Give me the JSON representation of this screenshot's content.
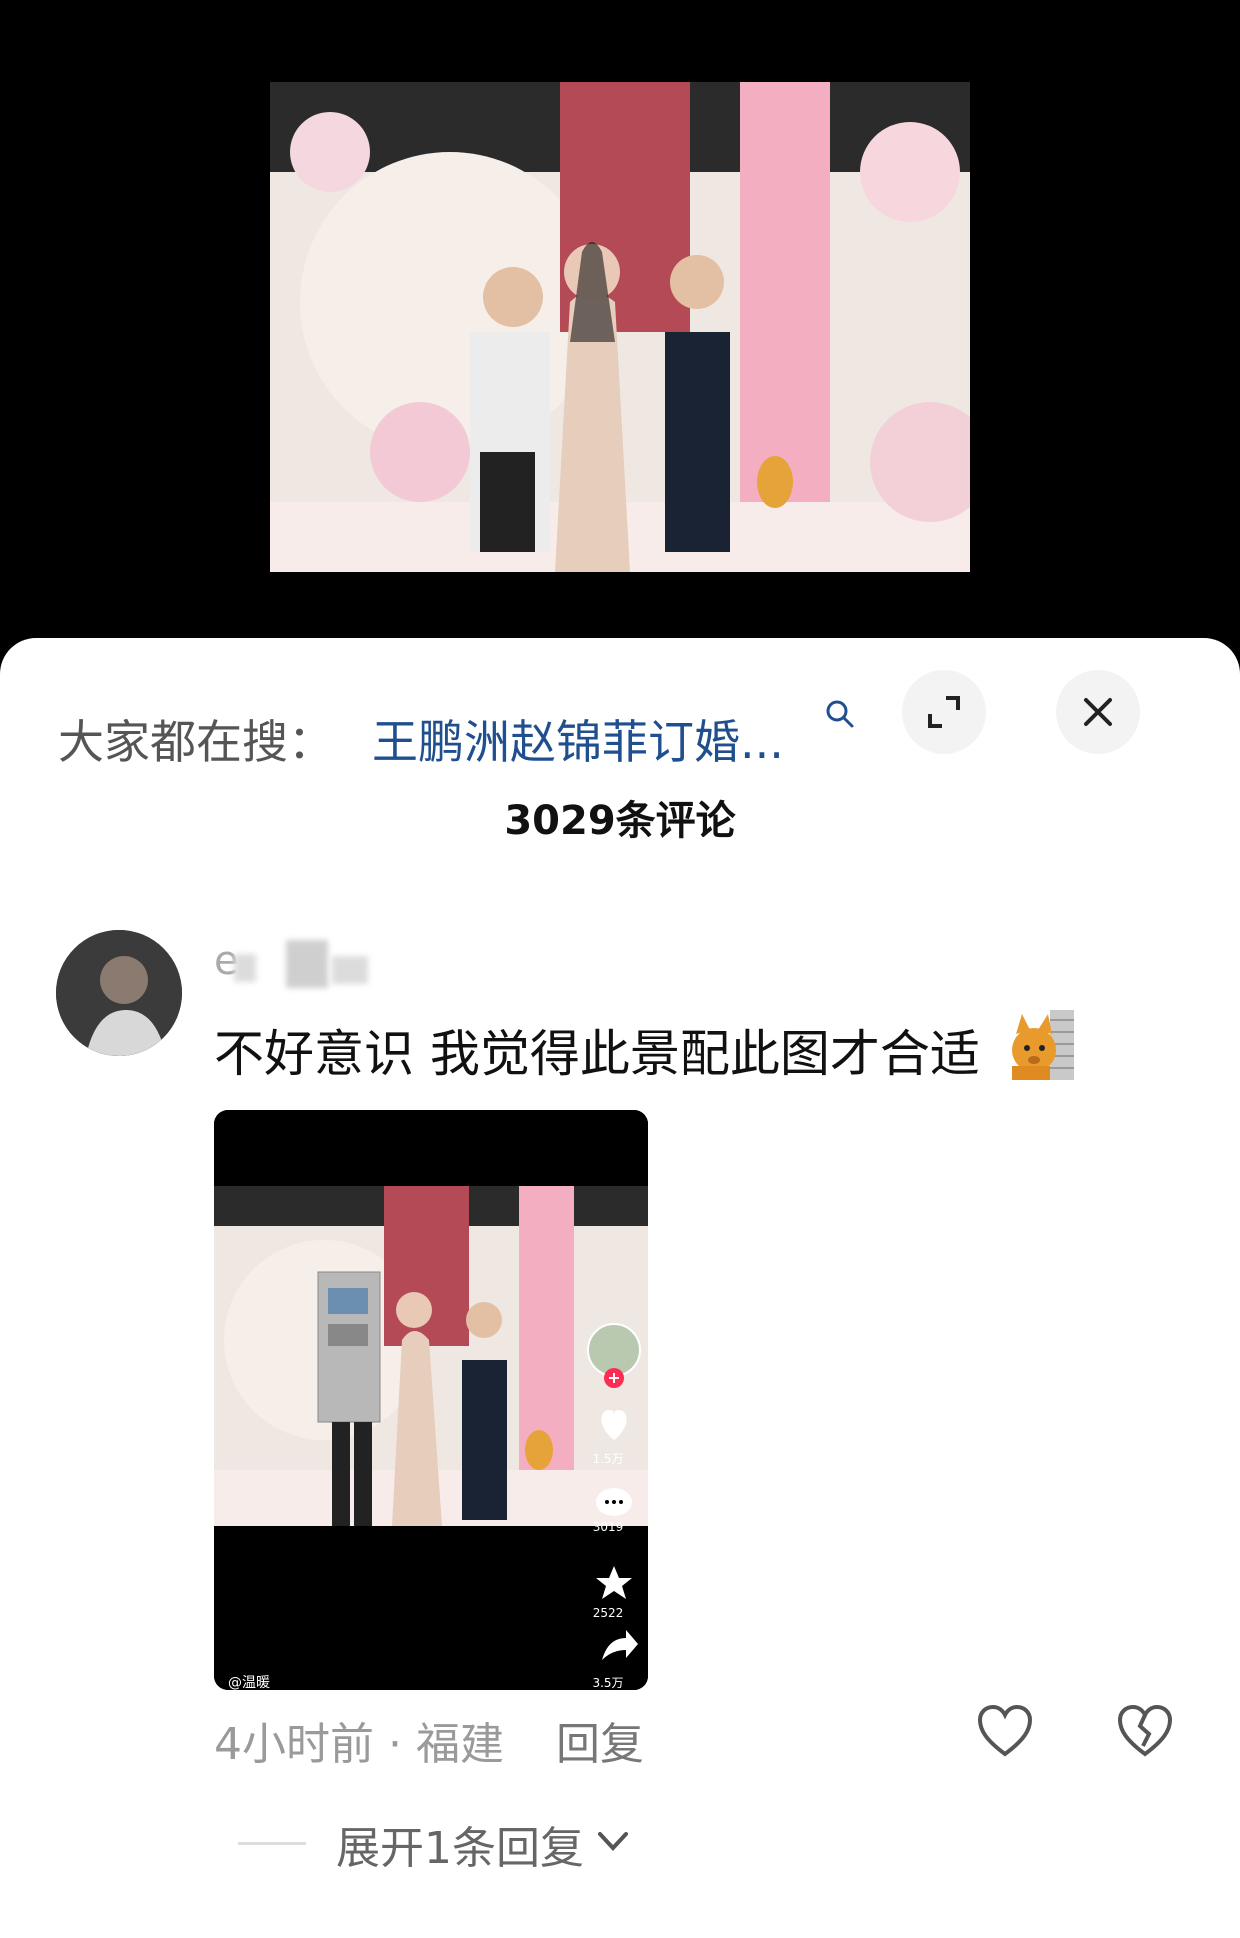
{
  "search": {
    "prefix": "大家都在搜：",
    "query": "王鹏洲赵锦菲订婚..."
  },
  "header": {
    "comment_count": "3029条评论"
  },
  "comment": {
    "username": "e",
    "text": "不好意识 我觉得此景配此图才合适",
    "time_location": "4小时前 · 福建",
    "reply_label": "回复",
    "expand_replies": "展开1条回复"
  },
  "thumbnail": {
    "likes": "1.5万",
    "comments": "3019",
    "favorites": "2522",
    "shares": "3.5万",
    "author": "@温暖"
  },
  "colors": {
    "link": "#1f4f8f",
    "sheet_bg": "#ffffff",
    "like_red": "#fe2c55"
  },
  "icons": [
    "search-icon",
    "expand-icon",
    "close-icon",
    "heart-icon",
    "broken-heart-icon",
    "chevron-down-icon",
    "comment-icon",
    "star-icon",
    "share-icon"
  ]
}
